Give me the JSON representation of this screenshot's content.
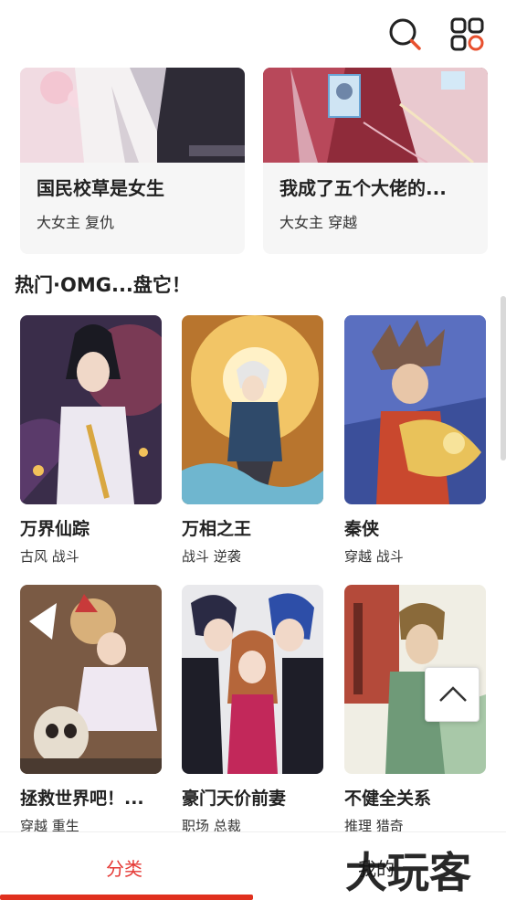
{
  "header": {
    "search_icon": "search-icon",
    "menu_icon": "grid-apps-icon",
    "accent": "#e8502e"
  },
  "featured": [
    {
      "title": "国民校草是女生",
      "tags": "大女主 复仇"
    },
    {
      "title": "我成了五个大佬的...",
      "tags": "大女主 穿越"
    }
  ],
  "section": {
    "title": "热门·OMG...盘它！"
  },
  "comics": [
    {
      "title": "万界仙踪",
      "tags": "古风 战斗"
    },
    {
      "title": "万相之王",
      "tags": "战斗 逆袭"
    },
    {
      "title": "秦侠",
      "tags": "穿越 战斗"
    },
    {
      "title": "拯救世界吧！...",
      "tags": "穿越 重生"
    },
    {
      "title": "豪门天价前妻",
      "tags": "职场 总裁"
    },
    {
      "title": "不健全关系",
      "tags": "推理 猎奇"
    }
  ],
  "bottom_nav": {
    "category_label": "分类",
    "mine_label": "我的",
    "active_color": "#e53935"
  },
  "watermark_text": "大玩客"
}
